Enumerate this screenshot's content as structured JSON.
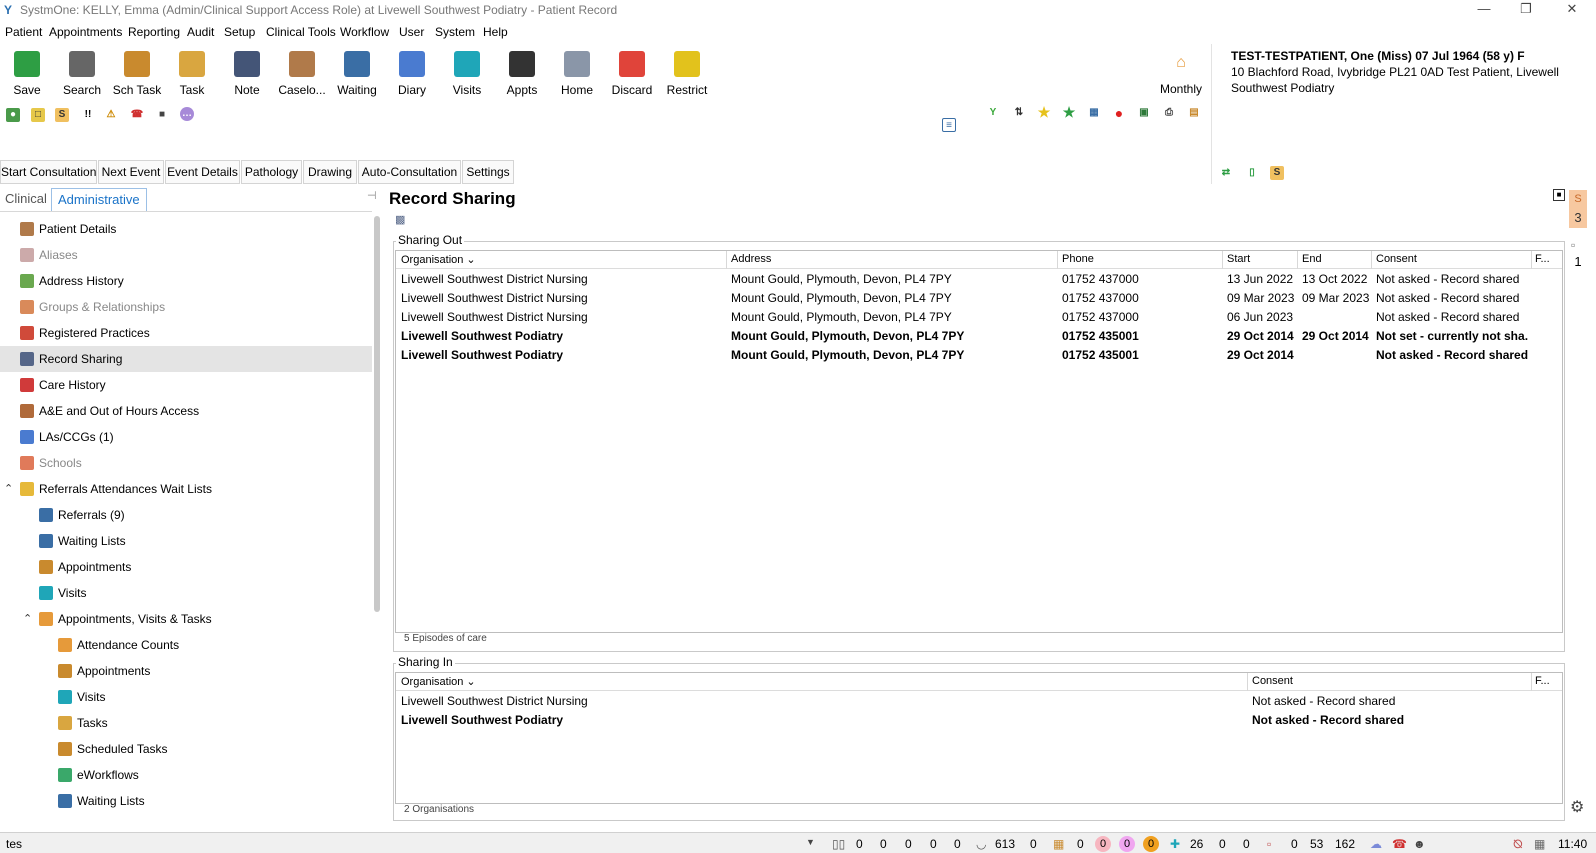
{
  "window": {
    "title": "SystmOne: KELLY, Emma (Admin/Clinical Support Access Role) at Livewell Southwest Podiatry - Patient Record"
  },
  "menu": [
    "Patient",
    "Appointments",
    "Reporting",
    "Audit",
    "Setup",
    "Clinical Tools",
    "Workflow",
    "User",
    "System",
    "Help"
  ],
  "toolbar": {
    "buttons": [
      {
        "label": "Save",
        "icon": "save-icon",
        "color": "#2e9e44"
      },
      {
        "label": "Search",
        "icon": "search-icon",
        "color": "#666666"
      },
      {
        "label": "Sch Task",
        "icon": "scheduled-task-icon",
        "color": "#c98a2e"
      },
      {
        "label": "Task",
        "icon": "task-icon",
        "color": "#d9a640"
      },
      {
        "label": "Note",
        "icon": "note-icon",
        "color": "#445577"
      },
      {
        "label": "Caselo...",
        "icon": "caseload-icon",
        "color": "#b07a4a"
      },
      {
        "label": "Waiting",
        "icon": "waiting-list-icon",
        "color": "#3a6ea5"
      },
      {
        "label": "Diary",
        "icon": "diary-icon",
        "color": "#4a7bd0"
      },
      {
        "label": "Visits",
        "icon": "visits-icon",
        "color": "#1fa6b8"
      },
      {
        "label": "Appts",
        "icon": "appointments-icon",
        "color": "#333333"
      },
      {
        "label": "Home",
        "icon": "home-icon",
        "color": "#8a96a8"
      },
      {
        "label": "Discard",
        "icon": "discard-icon",
        "color": "#e0443a"
      },
      {
        "label": "Restrict",
        "icon": "restrict-icon",
        "color": "#e2c21c"
      }
    ],
    "monthly_label": "Monthly"
  },
  "patient": {
    "name_line": "TEST-TESTPATIENT, One (Miss) 07 Jul 1964 (58 y) F",
    "address_line1": "10 Blachford Road, Ivybridge PL21 0AD  Test Patient, Livewell",
    "address_line2": "Southwest Podiatry"
  },
  "consult_buttons": [
    "Start Consultation",
    "Next Event",
    "Event Details",
    "Pathology",
    "Drawing",
    "Auto-Consultation",
    "Settings"
  ],
  "left_tabs": {
    "clinical": "Clinical",
    "administrative": "Administrative"
  },
  "nav": [
    {
      "label": "Patient Details",
      "icon": "patient-details-icon",
      "color": "#b07a4a",
      "indent": 0
    },
    {
      "label": "Aliases",
      "icon": "aliases-icon",
      "color": "#caa",
      "indent": 0,
      "dim": true
    },
    {
      "label": "Address History",
      "icon": "address-history-icon",
      "color": "#6aa84f",
      "indent": 0
    },
    {
      "label": "Groups & Relationships",
      "icon": "groups-icon",
      "color": "#d98a5a",
      "indent": 0,
      "dim": true
    },
    {
      "label": "Registered Practices",
      "icon": "registered-practices-icon",
      "color": "#d04a3a",
      "indent": 0
    },
    {
      "label": "Record Sharing",
      "icon": "record-sharing-icon",
      "color": "#556688",
      "indent": 0,
      "selected": true
    },
    {
      "label": "Care History",
      "icon": "care-history-icon",
      "color": "#d03a3a",
      "indent": 0
    },
    {
      "label": "A&E and Out of Hours Access",
      "icon": "ae-access-icon",
      "color": "#b06a3a",
      "indent": 0
    },
    {
      "label": "LAs/CCGs (1)",
      "icon": "las-ccgs-icon",
      "color": "#4a7bd0",
      "indent": 0
    },
    {
      "label": "Schools",
      "icon": "schools-icon",
      "color": "#e07a5a",
      "indent": 0,
      "dim": true
    },
    {
      "label": "Referrals Attendances Wait Lists",
      "icon": "folder-icon",
      "color": "#e6b93a",
      "indent": 0,
      "toggle": "^"
    },
    {
      "label": "Referrals (9)",
      "icon": "referral-arrow-icon",
      "color": "#3a6ea5",
      "indent": 1
    },
    {
      "label": "Waiting Lists",
      "icon": "waiting-list-icon",
      "color": "#3a6ea5",
      "indent": 1
    },
    {
      "label": "Appointments",
      "icon": "appointments-icon",
      "color": "#c98a2e",
      "indent": 1
    },
    {
      "label": "Visits",
      "icon": "visits-icon",
      "color": "#1fa6b8",
      "indent": 1
    },
    {
      "label": "Appointments, Visits & Tasks",
      "icon": "clock-icon",
      "color": "#e69a3a",
      "indent": 1,
      "toggle": "^"
    },
    {
      "label": "Attendance Counts",
      "icon": "attendance-counts-icon",
      "color": "#e69a3a",
      "indent": 2
    },
    {
      "label": "Appointments",
      "icon": "appointments-icon",
      "color": "#c98a2e",
      "indent": 2
    },
    {
      "label": "Visits",
      "icon": "visits-icon",
      "color": "#1fa6b8",
      "indent": 2
    },
    {
      "label": "Tasks",
      "icon": "tasks-icon",
      "color": "#d9a640",
      "indent": 2
    },
    {
      "label": "Scheduled Tasks",
      "icon": "scheduled-task-icon",
      "color": "#c98a2e",
      "indent": 2
    },
    {
      "label": "eWorkflows",
      "icon": "eworkflows-icon",
      "color": "#3aa86a",
      "indent": 2
    },
    {
      "label": "Waiting Lists",
      "icon": "waiting-list-icon",
      "color": "#3a6ea5",
      "indent": 2
    }
  ],
  "main": {
    "title": "Record Sharing",
    "sharing_out": {
      "title": "Sharing Out",
      "columns": [
        "Organisation",
        "Address",
        "Phone",
        "Start",
        "End",
        "Consent",
        "F..."
      ],
      "rows": [
        {
          "org": "Livewell Southwest District Nursing",
          "address": "Mount Gould, Plymouth, Devon, PL4 7PY",
          "phone": "01752 437000",
          "start": "13 Jun 2022",
          "end": "13 Oct 2022",
          "consent": "Not asked - Record shared",
          "bold": false
        },
        {
          "org": "Livewell Southwest District Nursing",
          "address": "Mount Gould, Plymouth, Devon, PL4 7PY",
          "phone": "01752 437000",
          "start": "09 Mar 2023",
          "end": "09 Mar 2023",
          "consent": "Not asked - Record shared",
          "bold": false
        },
        {
          "org": "Livewell Southwest District Nursing",
          "address": "Mount Gould, Plymouth, Devon, PL4 7PY",
          "phone": "01752 437000",
          "start": "06 Jun 2023",
          "end": "",
          "consent": "Not asked - Record shared",
          "bold": false
        },
        {
          "org": "Livewell Southwest Podiatry",
          "address": "Mount Gould, Plymouth, Devon, PL4 7PY",
          "phone": "01752 435001",
          "start": "29 Oct 2014",
          "end": "29 Oct 2014",
          "consent": "Not set - currently not sha...",
          "bold": true
        },
        {
          "org": "Livewell Southwest Podiatry",
          "address": "Mount Gould, Plymouth, Devon, PL4 7PY",
          "phone": "01752 435001",
          "start": "29 Oct 2014",
          "end": "",
          "consent": "Not asked - Record shared",
          "bold": true
        }
      ],
      "footer": "5 Episodes of care"
    },
    "sharing_in": {
      "title": "Sharing In",
      "columns": [
        "Organisation",
        "Consent",
        "F..."
      ],
      "rows": [
        {
          "org": "Livewell Southwest District Nursing",
          "consent": "Not asked - Record shared",
          "bold": false
        },
        {
          "org": "Livewell Southwest Podiatry",
          "consent": "Not asked - Record shared",
          "bold": true
        }
      ],
      "footer": "2 Organisations"
    }
  },
  "right_rail": {
    "badge1": "3",
    "badge2": "1"
  },
  "status": {
    "search_value": "tes",
    "counts_a": [
      "0",
      "0",
      "0",
      "0",
      "0"
    ],
    "count_613": "613",
    "count_613_b": "0",
    "count_c": "0",
    "circle_pink": "0",
    "circle_magenta": "0",
    "circle_orange": "0",
    "count_26": "26",
    "count_26_b": "0",
    "count_26_c": "0",
    "count_d": "0",
    "count_53": "53",
    "count_162": "162",
    "time": "11:40"
  }
}
